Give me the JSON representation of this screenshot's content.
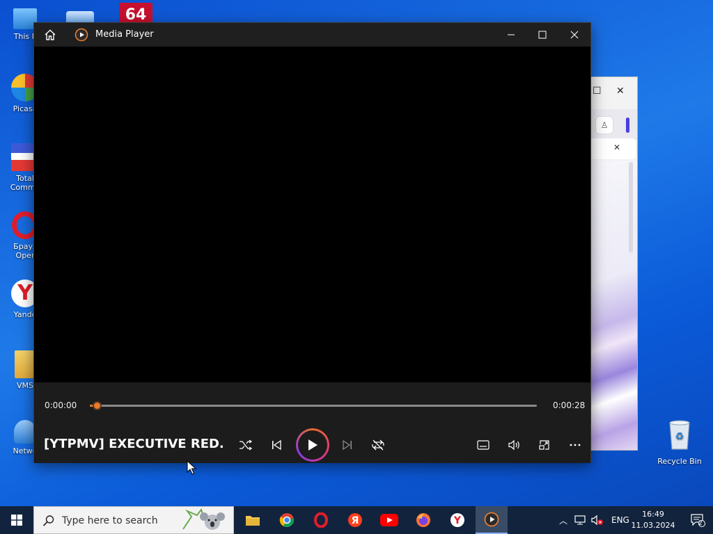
{
  "desktop": {
    "icons": [
      {
        "label": "This P"
      },
      {
        "label": "Picasa"
      },
      {
        "label": "Total Comma"
      },
      {
        "label": "Брауз Oper"
      },
      {
        "label": "Yande"
      },
      {
        "label": "VMS"
      },
      {
        "label": "Netwo"
      }
    ],
    "recycle_bin": "Recycle Bin"
  },
  "media_player": {
    "title": "Media Player",
    "now_playing": "[YTPMV] EXECUTIVE RED...",
    "time_current": "0:00:00",
    "time_total": "0:00:28",
    "progress_fraction": 0.0
  },
  "taskbar": {
    "search_placeholder": "Type here to search",
    "language": "ENG",
    "time": "16:49",
    "date": "11.03.2024",
    "notifications": "2"
  },
  "colors": {
    "accent": "#e97b2c",
    "taskbar": "#12233d",
    "desktop": "#1f7ae8"
  }
}
